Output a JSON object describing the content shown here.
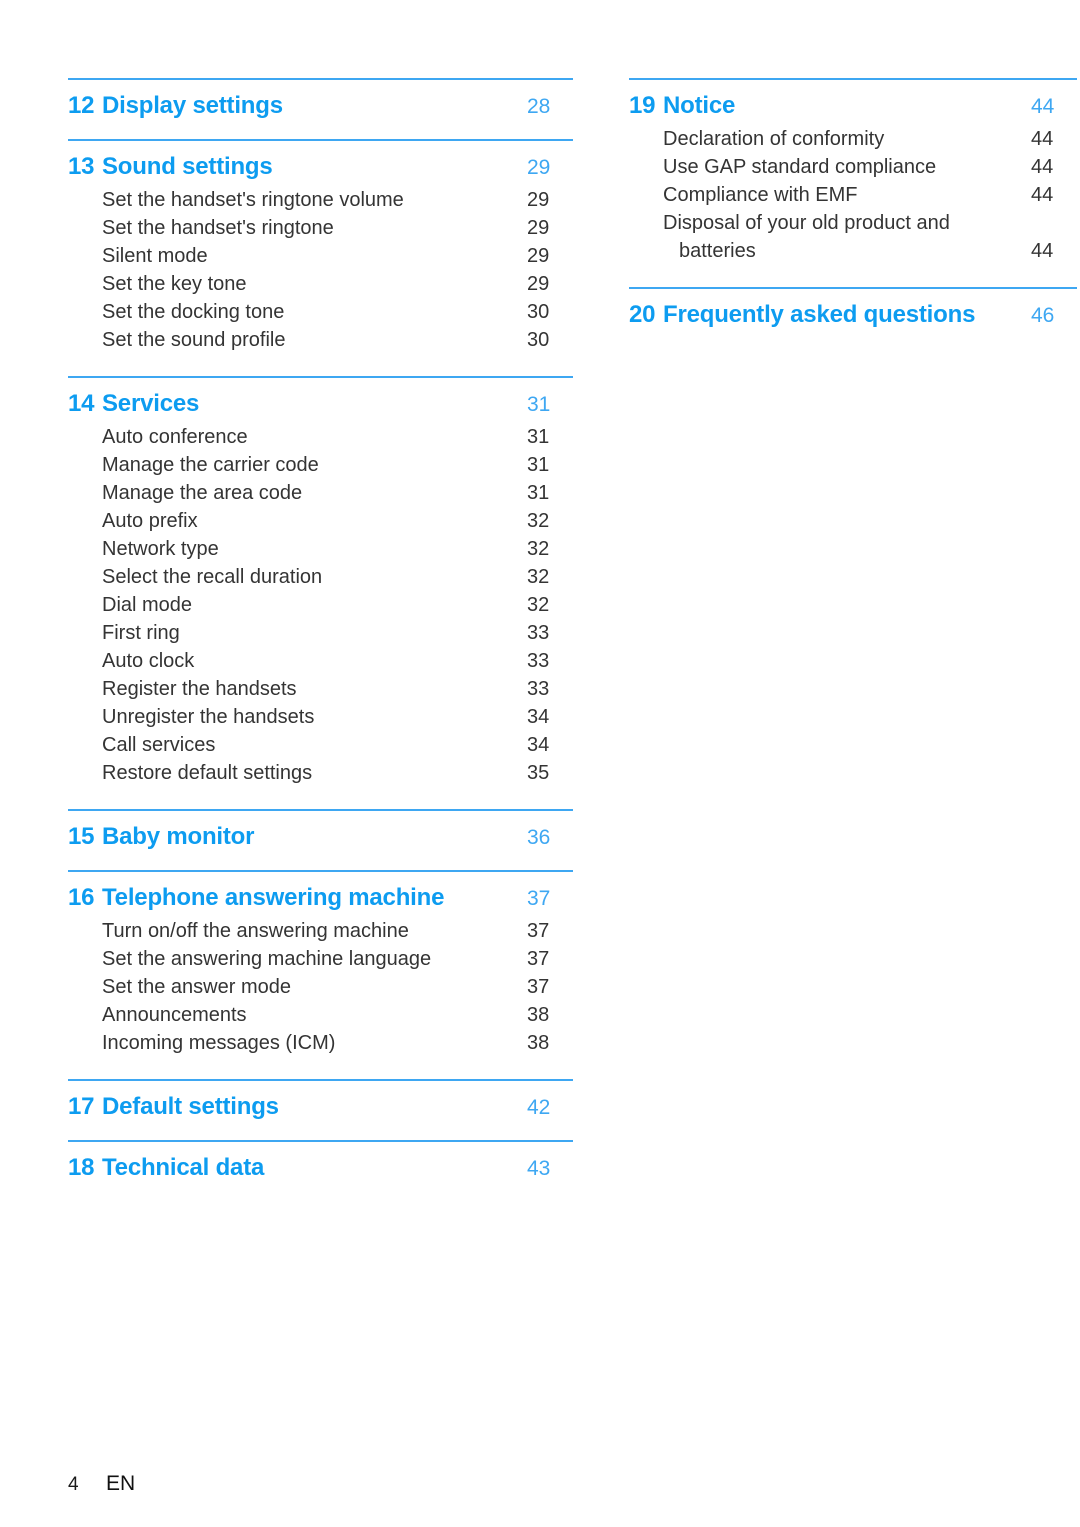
{
  "document": {
    "type": "table-of-contents",
    "footer": {
      "page_number": "4",
      "language": "EN"
    },
    "colors": {
      "heading_blue": "#0d9cf0",
      "rule_blue": "#3ea7f2",
      "page_number_blue": "#3ea7f2",
      "body_text": "#343434"
    }
  },
  "left_column": {
    "sections": [
      {
        "number": "12",
        "title": "Display settings",
        "page": "28",
        "items": []
      },
      {
        "number": "13",
        "title": "Sound settings",
        "page": "29",
        "items": [
          {
            "label": "Set the handset's ringtone volume",
            "page": "29"
          },
          {
            "label": "Set the handset's ringtone",
            "page": "29"
          },
          {
            "label": "Silent mode",
            "page": "29"
          },
          {
            "label": "Set the key tone",
            "page": "29"
          },
          {
            "label": "Set the docking tone",
            "page": "30"
          },
          {
            "label": "Set the sound profile",
            "page": "30"
          }
        ]
      },
      {
        "number": "14",
        "title": "Services",
        "page": "31",
        "items": [
          {
            "label": "Auto conference",
            "page": "31"
          },
          {
            "label": "Manage the carrier code",
            "page": "31"
          },
          {
            "label": "Manage the area code",
            "page": "31"
          },
          {
            "label": "Auto prefix",
            "page": "32"
          },
          {
            "label": "Network type",
            "page": "32"
          },
          {
            "label": "Select the recall duration",
            "page": "32"
          },
          {
            "label": "Dial mode",
            "page": "32"
          },
          {
            "label": "First ring",
            "page": "33"
          },
          {
            "label": "Auto clock",
            "page": "33"
          },
          {
            "label": "Register the handsets",
            "page": "33"
          },
          {
            "label": "Unregister the handsets",
            "page": "34"
          },
          {
            "label": "Call services",
            "page": "34"
          },
          {
            "label": "Restore default settings",
            "page": "35"
          }
        ]
      },
      {
        "number": "15",
        "title": "Baby monitor",
        "page": "36",
        "items": []
      },
      {
        "number": "16",
        "title": "Telephone answering machine",
        "page": "37",
        "items": [
          {
            "label": "Turn on/off the answering machine",
            "page": "37"
          },
          {
            "label": "Set the answering machine language",
            "page": "37"
          },
          {
            "label": "Set the answer mode",
            "page": "37"
          },
          {
            "label": "Announcements",
            "page": "38"
          },
          {
            "label": "Incoming messages (ICM)",
            "page": "38"
          }
        ]
      },
      {
        "number": "17",
        "title": "Default settings",
        "page": "42",
        "items": []
      },
      {
        "number": "18",
        "title": "Technical data",
        "page": "43",
        "items": []
      }
    ]
  },
  "right_column": {
    "sections": [
      {
        "number": "19",
        "title": "Notice",
        "page": "44",
        "items": [
          {
            "label": "Declaration of conformity",
            "page": "44"
          },
          {
            "label": "Use GAP standard compliance",
            "page": "44"
          },
          {
            "label": "Compliance with EMF",
            "page": "44"
          },
          {
            "label": "Disposal of your old product and",
            "page": ""
          },
          {
            "label": "batteries",
            "page": "44",
            "indent": true
          }
        ]
      },
      {
        "number": "20",
        "title": "Frequently asked questions",
        "page": "46",
        "items": []
      }
    ]
  }
}
